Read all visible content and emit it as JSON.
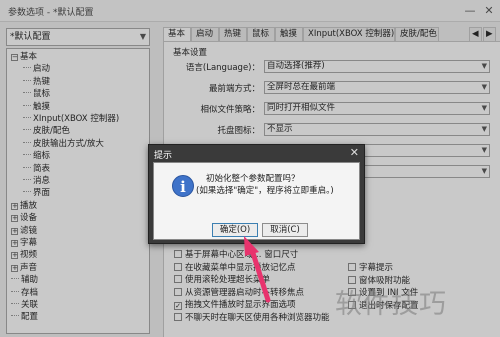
{
  "window": {
    "title": "参数选项 - *默认配置",
    "btn_minimize": "—",
    "btn_close": "✕"
  },
  "profile": {
    "selected": "*默认配置"
  },
  "tree": {
    "items": [
      {
        "label": "基本",
        "indent": 0,
        "expander": "−"
      },
      {
        "label": "启动",
        "indent": 1
      },
      {
        "label": "热键",
        "indent": 1
      },
      {
        "label": "鼠标",
        "indent": 1
      },
      {
        "label": "触摸",
        "indent": 1
      },
      {
        "label": "XInput(XBOX 控制器)",
        "indent": 1
      },
      {
        "label": "皮肤/配色",
        "indent": 1
      },
      {
        "label": "皮肤输出方式/放大",
        "indent": 1
      },
      {
        "label": "缩标",
        "indent": 1
      },
      {
        "label": "简表",
        "indent": 1
      },
      {
        "label": "消息",
        "indent": 1
      },
      {
        "label": "界面",
        "indent": 1
      },
      {
        "label": "播放",
        "indent": 0,
        "expander": "+"
      },
      {
        "label": "设备",
        "indent": 0,
        "expander": "+"
      },
      {
        "label": "滤镜",
        "indent": 0,
        "expander": "+"
      },
      {
        "label": "字幕",
        "indent": 0,
        "expander": "+"
      },
      {
        "label": "视频",
        "indent": 0,
        "expander": "+"
      },
      {
        "label": "声音",
        "indent": 0,
        "expander": "+"
      },
      {
        "label": "辅助",
        "indent": 0
      },
      {
        "label": "存档",
        "indent": 0
      },
      {
        "label": "关联",
        "indent": 0
      },
      {
        "label": "配置",
        "indent": 0
      }
    ]
  },
  "tabs": {
    "items": [
      "基本",
      "启动",
      "热键",
      "鼠标",
      "触摸",
      "XInput(XBOX 控制器)",
      "皮肤/配色"
    ],
    "active": 0,
    "nav_left": "◀",
    "nav_right": "▶"
  },
  "basic": {
    "section_title": "基本设置",
    "fields": [
      {
        "label": "语言(Language)：",
        "value": "自动选择(推荐)"
      },
      {
        "label": "最前端方式：",
        "value": "全屏时总在最前端"
      },
      {
        "label": "相似文件策略：",
        "value": "同时打开相似文件"
      },
      {
        "label": "托盘图标：",
        "value": "不显示"
      },
      {
        "label": "",
        "value": ""
      },
      {
        "label": "",
        "value": ""
      }
    ],
    "left_checks": [
      {
        "label": "基于屏幕中心区域… 窗口尺寸",
        "checked": false
      },
      {
        "label": "在收藏菜单中显示播放记忆点",
        "checked": false
      },
      {
        "label": "使用滚轮处理超长菜单",
        "checked": false
      },
      {
        "label": "从资源管理器启动时不转移焦点",
        "checked": false
      },
      {
        "label": "拖拽文件播放时显示界面选项",
        "checked": true
      },
      {
        "label": "不聊天时在聊天区使用各种浏览器功能",
        "checked": false
      }
    ],
    "right_checks": [
      {
        "label": "字幕提示",
        "checked": false
      },
      {
        "label": "窗体吸附功能",
        "checked": false
      },
      {
        "label": "设置到 INI 文件",
        "checked": false
      },
      {
        "label": "退出时保存配置",
        "checked": false
      }
    ]
  },
  "dialog": {
    "title": "提示",
    "close": "✕",
    "icon": "info-icon",
    "icon_glyph": "i",
    "message_line1": "初始化整个参数配置吗？",
    "message_line2": "(如果选择\"确定\"，程序将立即重启。)",
    "ok_label": "确定(O)",
    "cancel_label": "取消(C)"
  },
  "watermark": "软件技巧",
  "colors": {
    "dialog_frame": "#3a3a3a",
    "info_icon": "#3f73c9",
    "pointer_arrow": "#e8336d"
  }
}
